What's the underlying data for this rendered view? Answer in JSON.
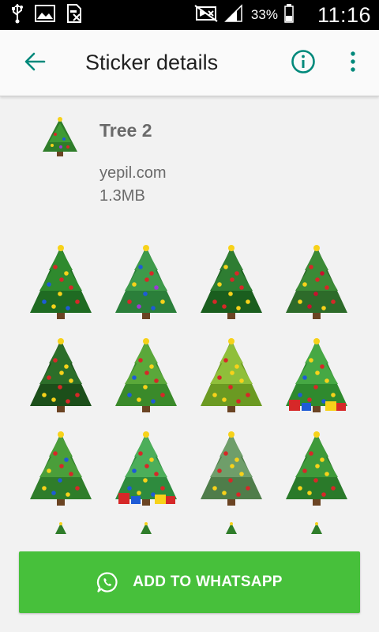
{
  "status_bar": {
    "icons": [
      "usb-icon",
      "image-icon",
      "no-sim-icon",
      "mute-icon",
      "signal-icon",
      "battery-icon"
    ],
    "battery_percent": "33%",
    "time": "11:16"
  },
  "app_bar": {
    "title": "Sticker details",
    "back_icon": "arrow-back-icon",
    "info_icon": "info-icon",
    "more_icon": "more-vert-icon",
    "accent_color": "#00897b"
  },
  "pack": {
    "name": "Tree 2",
    "publisher": "yepil.com",
    "size": "1.3MB",
    "tray_icon": "christmas-tree-icon"
  },
  "stickers": [
    {
      "name": "christmas-tree-1"
    },
    {
      "name": "christmas-tree-2"
    },
    {
      "name": "christmas-tree-3"
    },
    {
      "name": "christmas-tree-4"
    },
    {
      "name": "christmas-tree-5"
    },
    {
      "name": "christmas-tree-6"
    },
    {
      "name": "christmas-tree-7"
    },
    {
      "name": "christmas-tree-8"
    },
    {
      "name": "christmas-tree-9"
    },
    {
      "name": "christmas-tree-10"
    },
    {
      "name": "christmas-tree-11"
    },
    {
      "name": "christmas-tree-12"
    },
    {
      "name": "christmas-tree-13"
    },
    {
      "name": "christmas-tree-14"
    },
    {
      "name": "christmas-tree-15"
    },
    {
      "name": "christmas-tree-16"
    }
  ],
  "add_button": {
    "label": "ADD TO WHATSAPP",
    "icon": "whatsapp-icon",
    "color": "#47c03b"
  }
}
